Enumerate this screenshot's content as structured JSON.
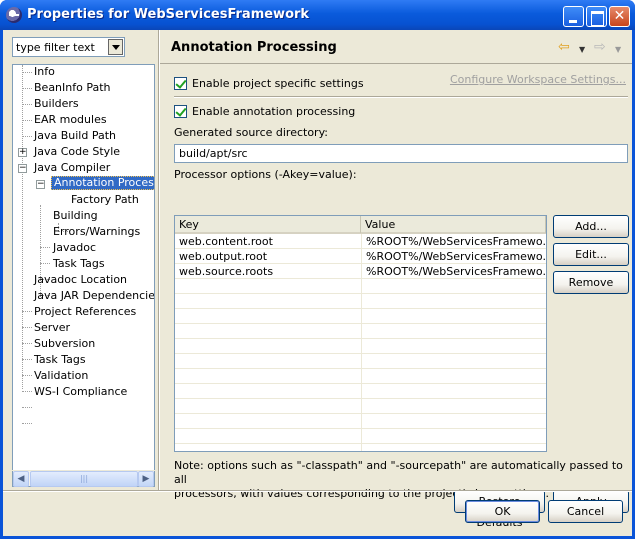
{
  "window": {
    "title": "Properties for WebServicesFramework"
  },
  "filter": {
    "value": "type filter text"
  },
  "tree": {
    "items": [
      {
        "label": "Info"
      },
      {
        "label": "BeanInfo Path"
      },
      {
        "label": "Builders"
      },
      {
        "label": "EAR modules"
      },
      {
        "label": "Java Build Path"
      },
      {
        "label": "Java Code Style",
        "expander": "+"
      },
      {
        "label": "Java Compiler",
        "expander": "−"
      },
      {
        "label": "Annotation Processing",
        "expander": "−",
        "selected": true
      },
      {
        "label": "Factory Path"
      },
      {
        "label": "Building"
      },
      {
        "label": "Errors/Warnings"
      },
      {
        "label": "Javadoc"
      },
      {
        "label": "Task Tags"
      },
      {
        "label": "Javadoc Location"
      },
      {
        "label": "Java JAR Dependencies"
      },
      {
        "label": "Project References"
      },
      {
        "label": "Server"
      },
      {
        "label": "Subversion"
      },
      {
        "label": "Task Tags"
      },
      {
        "label": "Validation"
      },
      {
        "label": "WS-I Compliance"
      }
    ]
  },
  "page": {
    "title": "Annotation Processing",
    "enable_project_settings": "Enable project specific settings",
    "configure_link": "Configure Workspace Settings...",
    "enable_annotation": "Enable annotation processing",
    "gen_src_label": "Generated source directory:",
    "gen_src_value": "build/apt/src",
    "proc_options_label": "Processor options (-Akey=value):",
    "table": {
      "columns": [
        "Key",
        "Value"
      ],
      "rows": [
        {
          "key": "web.content.root",
          "value": "%ROOT%/WebServicesFramewo..."
        },
        {
          "key": "web.output.root",
          "value": "%ROOT%/WebServicesFramewo..."
        },
        {
          "key": "web.source.roots",
          "value": "%ROOT%/WebServicesFramewo..."
        }
      ]
    },
    "add_label": "Add...",
    "edit_label": "Edit...",
    "remove_label": "Remove",
    "note_line1": "Note: options such as \"-classpath\" and \"-sourcepath\" are automatically passed to all",
    "note_line2": "processors, with values corresponding to the project's Java settings.",
    "restore_label": "Restore Defaults",
    "apply_label": "Apply"
  },
  "dialog": {
    "ok_label": "OK",
    "cancel_label": "Cancel"
  },
  "icons": {
    "back": "back-arrow-icon",
    "forward": "forward-arrow-icon"
  },
  "colors": {
    "title_bar": "#0a5bdc",
    "selection": "#316ac5",
    "dialog_bg": "#ece9d8"
  }
}
